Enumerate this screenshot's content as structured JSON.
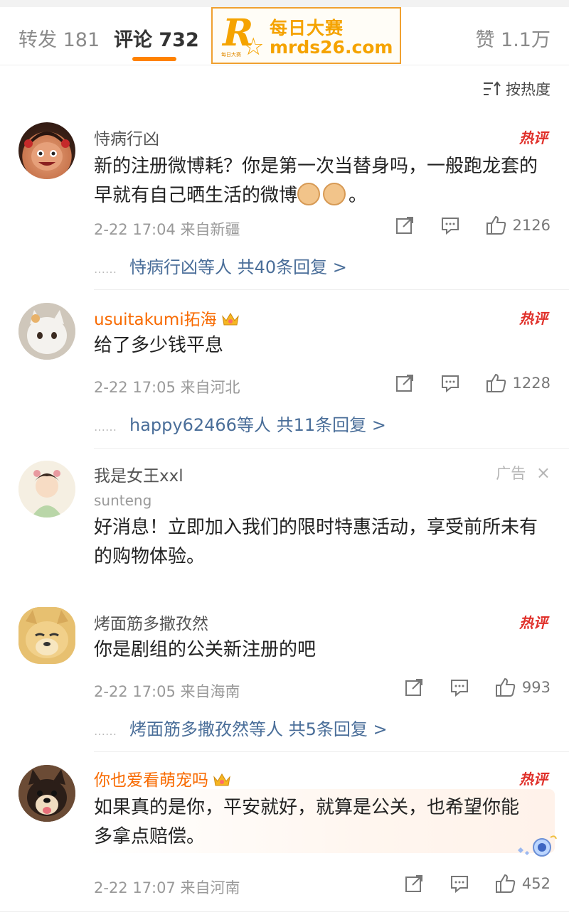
{
  "tabs": [
    {
      "label": "转发 181"
    },
    {
      "label": "评论 732"
    },
    {
      "label": "赞 1.1万"
    }
  ],
  "watermark": {
    "cn": "每日大赛",
    "url": "mrds26.com",
    "small": "每日大赛"
  },
  "sort_label": "按热度",
  "hot_badge_label": "热评",
  "comments": [
    {
      "user": "恃病行凶",
      "text": "新的注册微博耗？你是第一次当替身吗，一般跑龙套的早就有自己晒生活的微博",
      "text_suffix": "。",
      "time": "2-22 17:04",
      "location": "来自新疆",
      "likes": "2126",
      "replies": {
        "dots": "……",
        "label": "恃病行凶等人 共40条回复 >"
      }
    },
    {
      "user": "usuitakumi拓海",
      "text": "给了多少钱平息",
      "time": "2-22 17:05",
      "location": "来自河北",
      "likes": "1228",
      "replies": {
        "dots": "……",
        "label": "happy62466等人 共11条回复 >"
      }
    },
    {
      "user": "烤面筋多撒孜然",
      "text": "你是剧组的公关新注册的吧",
      "time": "2-22 17:05",
      "location": "来自海南",
      "likes": "993",
      "replies": {
        "dots": "……",
        "label": "烤面筋多撒孜然等人 共5条回复 >"
      }
    },
    {
      "user": "你也爱看萌宠吗",
      "text": "如果真的是你，平安就好，就算是公关，也希望你能多拿点赔偿。",
      "time": "2-22 17:07",
      "location": "来自河南",
      "likes": "452"
    }
  ],
  "ad": {
    "user": "我是女王xxl",
    "sub": "sunteng",
    "tag": "广告",
    "close": "×",
    "text": "好消息！立即加入我们的限时特惠活动，享受前所未有的购物体验。"
  },
  "colors": {
    "accent": "#ff8200",
    "reply_link": "#4a6e99",
    "hot": "#e0302a",
    "vip_name": "#f86a00"
  }
}
